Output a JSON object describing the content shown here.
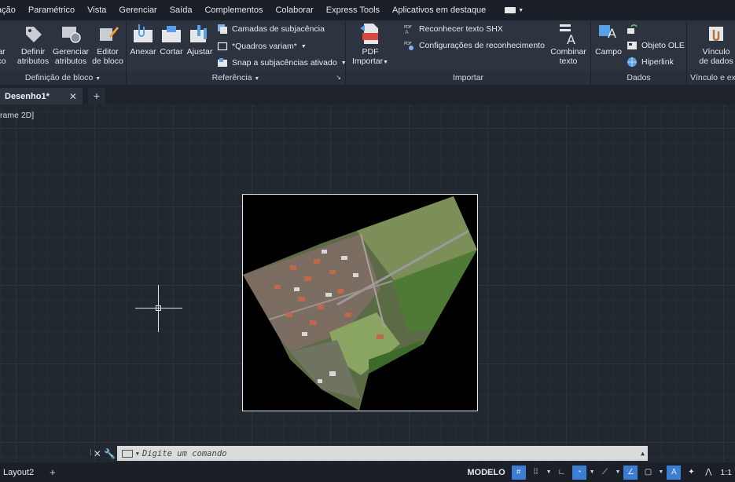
{
  "menu": [
    "ação",
    "Paramétrico",
    "Vista",
    "Gerenciar",
    "Saída",
    "Complementos",
    "Colaborar",
    "Express Tools",
    "Aplicativos em destaque"
  ],
  "ribbon": {
    "bloco": {
      "title": "Definição de bloco",
      "buttons": [
        {
          "line1": "ar",
          "line2": "co"
        },
        {
          "line1": "Definir",
          "line2": "atributos"
        },
        {
          "line1": "Gerenciar",
          "line2": "atributos"
        },
        {
          "line1": "Editor",
          "line2": "de bloco"
        }
      ]
    },
    "referencia": {
      "title": "Referência",
      "buttons": [
        "Anexar",
        "Cortar",
        "Ajustar"
      ],
      "small": [
        "Camadas de subjacência",
        "*Quadros variam*",
        "Snap a subjacências ativado"
      ]
    },
    "importar": {
      "title": "Importar",
      "pdf_line1": "PDF",
      "pdf_line2": "Importar",
      "small": [
        "Reconhecer texto SHX",
        "Configurações de reconhecimento"
      ],
      "combinar_line1": "Combinar",
      "combinar_line2": "texto"
    },
    "dados": {
      "title": "Dados",
      "campo": "Campo",
      "small": [
        "Objeto OLE",
        "Hiperlink"
      ]
    },
    "vinculo": {
      "title": "Vínculo e ex",
      "line1": "Vínculo",
      "line2": "de dados"
    }
  },
  "tabs": {
    "active": "Desenho1*",
    "close": "✕",
    "add": "+"
  },
  "viewport_label": "rame 2D]",
  "command": {
    "placeholder": "Digite um comando"
  },
  "status": {
    "layout": "Layout2",
    "add": "+",
    "model": "MODELO",
    "scale": "1:1"
  }
}
